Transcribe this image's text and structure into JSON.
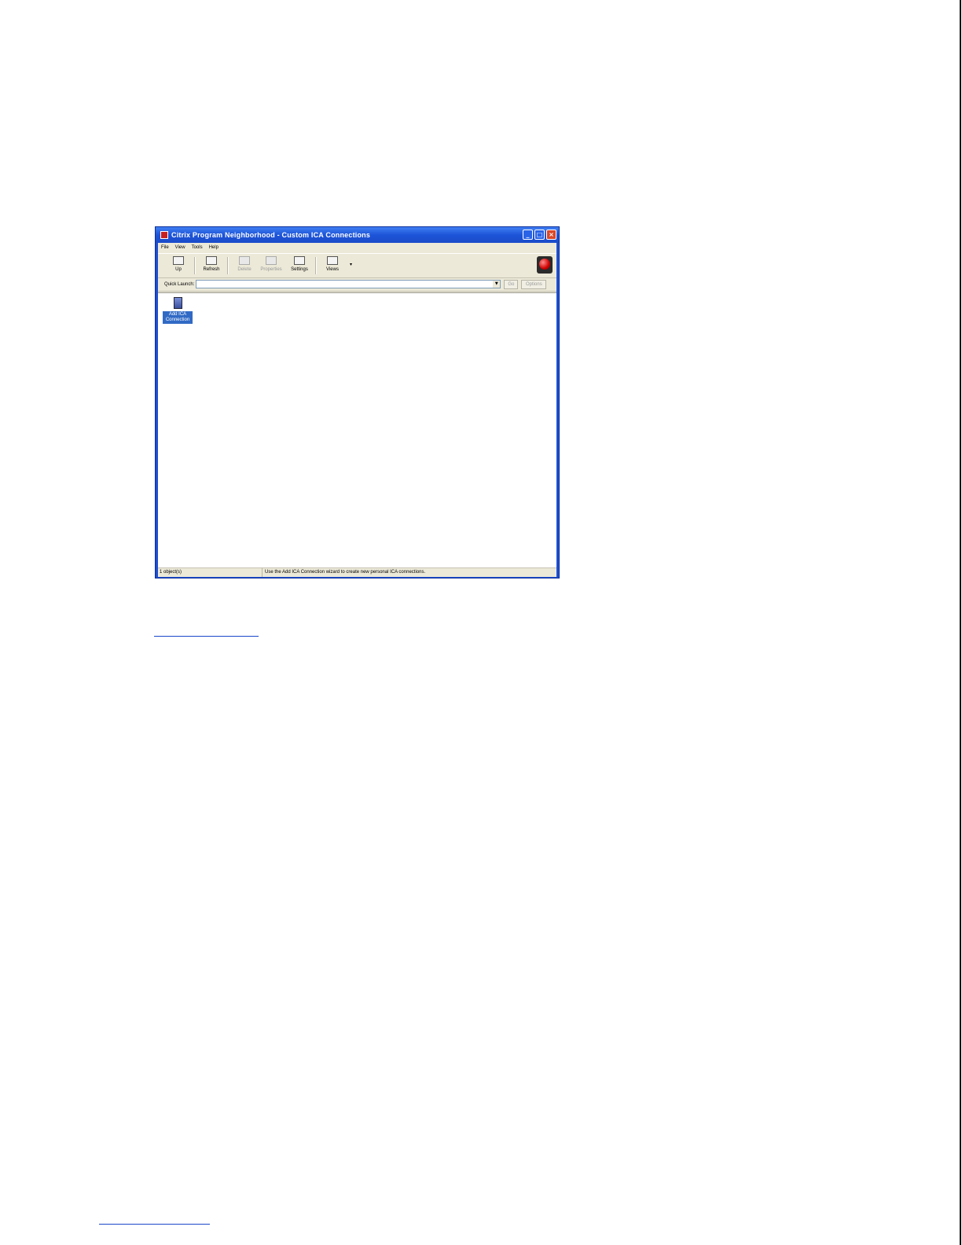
{
  "window": {
    "title": "Citrix Program Neighborhood - Custom ICA Connections",
    "controls": {
      "minimize": "_",
      "maximize": "□",
      "close": "×"
    }
  },
  "menu": [
    "File",
    "View",
    "Tools",
    "Help"
  ],
  "toolbar": {
    "up": "Up",
    "refresh": "Refresh",
    "delete": "Delete",
    "properties": "Properties",
    "settings": "Settings",
    "views": "Views",
    "views_arrow": "▾"
  },
  "quick_launch": {
    "label": "Quick Launch:",
    "value": "",
    "dropdown": "▼",
    "go": "Go",
    "options": "Options"
  },
  "items": [
    {
      "label_line1": "Add ICA",
      "label_line2": "Connection"
    }
  ],
  "status": {
    "count": "1 object(s)",
    "message": "Use the Add ICA Connection wizard to create new personal ICA connections."
  },
  "icons": [
    "citrix-app-icon",
    "up-folder-icon",
    "refresh-icon",
    "delete-icon",
    "properties-icon",
    "settings-icon",
    "views-icon",
    "citrix-logo-icon",
    "add-ica-connection-icon"
  ]
}
